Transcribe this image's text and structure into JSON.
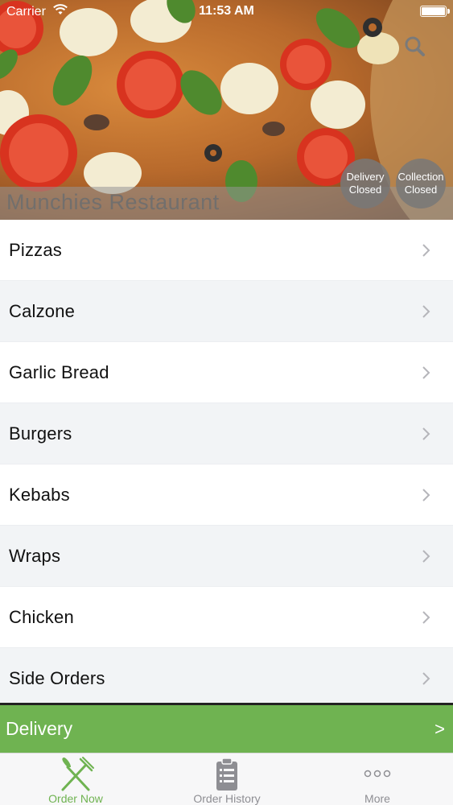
{
  "status_bar": {
    "carrier": "Carrier",
    "time": "11:53 AM"
  },
  "hero": {
    "restaurant_name": "Munchies Restaurant",
    "search_icon": "search-icon",
    "badges": {
      "delivery": {
        "line1": "Delivery",
        "line2": "Closed"
      },
      "collection": {
        "line1": "Collection",
        "line2": "Closed"
      }
    }
  },
  "categories": [
    {
      "label": "Pizzas"
    },
    {
      "label": "Calzone"
    },
    {
      "label": "Garlic Bread"
    },
    {
      "label": "Burgers"
    },
    {
      "label": "Kebabs"
    },
    {
      "label": "Wraps"
    },
    {
      "label": "Chicken"
    },
    {
      "label": "Side Orders"
    }
  ],
  "delivery_bar": {
    "label": "Delivery",
    "arrow": ">"
  },
  "tabs": {
    "order_now": "Order Now",
    "order_history": "Order History",
    "more": "More"
  },
  "colors": {
    "accent_green": "#6fb351",
    "inactive_gray": "#8e8e93"
  }
}
